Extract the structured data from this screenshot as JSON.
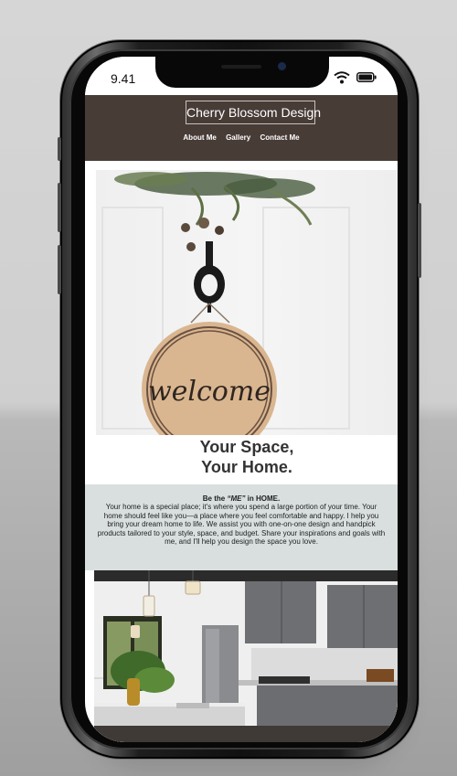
{
  "status_bar": {
    "time": "9.41"
  },
  "site": {
    "brand": "Cherry Blossom Design",
    "nav": [
      "About Me",
      "Gallery",
      "Contact Me"
    ]
  },
  "hero": {
    "title_line1": "Your Space,",
    "title_line2": "Your Home.",
    "sign_text": "welcome"
  },
  "intro": {
    "heading_prefix": "Be the ",
    "heading_emphasis": "“ME”",
    "heading_suffix": " in HOME.",
    "body": "Your home is a special place; it's where you spend a large portion of your time. Your home should feel like you—a place where you feel comfortable and happy. I help you bring your dream home to life. We assist you with one-on-one design and handpick products tailored to your style, space, and budget. Share your inspirations and goals with me, and I'll help you design the space you love."
  },
  "colors": {
    "nav_background": "#483c37",
    "intro_background": "#d9dfdf",
    "page_background": "#d2d2d2"
  },
  "icons": [
    "wifi-icon",
    "battery-icon"
  ]
}
